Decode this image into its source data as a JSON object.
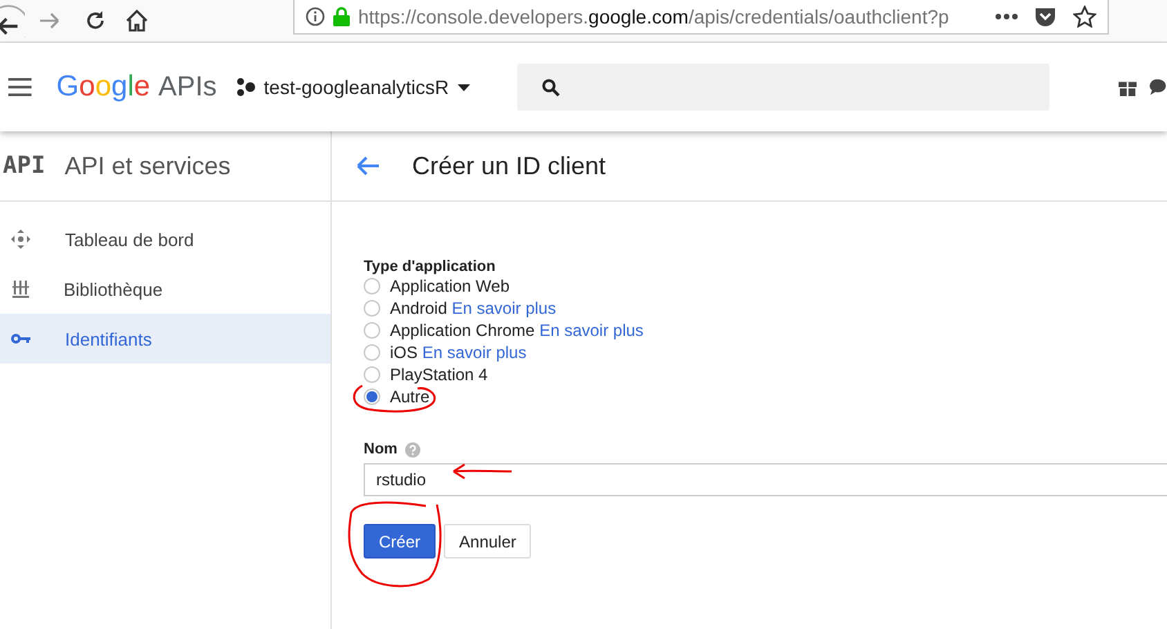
{
  "browser": {
    "url_host_prefix": "https://console.developers.",
    "url_host": "google.com",
    "url_path": "/apis/credentials/oauthclient?p"
  },
  "header": {
    "logo": "Google",
    "product": "APIs",
    "project": "test-googleanalyticsR"
  },
  "sidebar": {
    "badge": "API",
    "title": "API et services",
    "items": [
      {
        "label": "Tableau de bord",
        "kind": "dashboard",
        "selected": false
      },
      {
        "label": "Bibliothèque",
        "kind": "library",
        "selected": false
      },
      {
        "label": "Identifiants",
        "kind": "key",
        "selected": true
      }
    ]
  },
  "page": {
    "title": "Créer un ID client"
  },
  "form": {
    "type_label": "Type d'application",
    "options": [
      {
        "label": "Application Web",
        "selected": false
      },
      {
        "label": "Android",
        "link": "En savoir plus",
        "selected": false
      },
      {
        "label": "Application Chrome",
        "link": "En savoir plus",
        "selected": false
      },
      {
        "label": "iOS",
        "link": "En savoir plus",
        "selected": false
      },
      {
        "label": "PlayStation 4",
        "selected": false
      },
      {
        "label": "Autre",
        "selected": true
      }
    ],
    "name_label": "Nom",
    "name_value": "rstudio",
    "buttons": [
      {
        "label": "Créer",
        "kind": "primary"
      },
      {
        "label": "Annuler",
        "kind": "secondary"
      }
    ]
  }
}
